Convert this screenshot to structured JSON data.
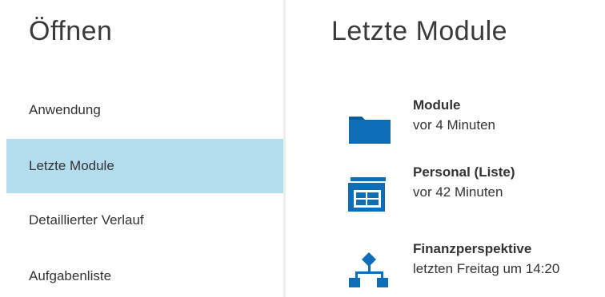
{
  "sidebar": {
    "title": "Öffnen",
    "items": [
      {
        "label": "Anwendung",
        "selected": false
      },
      {
        "label": "Letzte Module",
        "selected": true
      },
      {
        "label": "Detaillierter Verlauf",
        "selected": false
      },
      {
        "label": "Aufgabenliste",
        "selected": false
      }
    ],
    "selected_color": "#b3dcec"
  },
  "main": {
    "title": "Letzte Module",
    "modules": [
      {
        "name": "Module",
        "time": "vor 4 Minuten",
        "icon": "folder-icon"
      },
      {
        "name": "Personal (Liste)",
        "time": "vor 42 Minuten",
        "icon": "list-form-icon"
      },
      {
        "name": "Finanzperspektive",
        "time": "letzten Freitag um 14:20",
        "icon": "hierarchy-icon"
      }
    ]
  },
  "colors": {
    "icon_blue": "#0e6fb8"
  }
}
